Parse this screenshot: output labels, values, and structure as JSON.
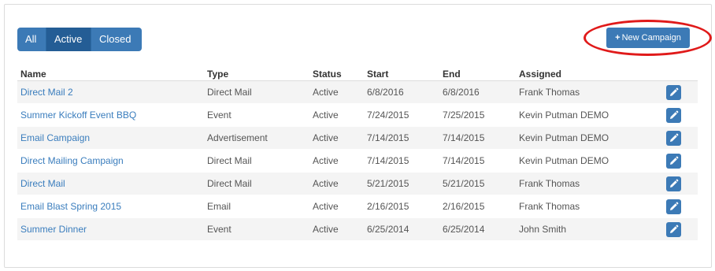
{
  "filters": [
    {
      "label": "All",
      "active": false
    },
    {
      "label": "Active",
      "active": true
    },
    {
      "label": "Closed",
      "active": false
    }
  ],
  "new_campaign_label": "New Campaign",
  "highlight_color": "#e01a1a",
  "accent_color": "#3c7ab6",
  "columns": [
    "Name",
    "Type",
    "Status",
    "Start",
    "End",
    "Assigned"
  ],
  "rows": [
    {
      "name": "Direct Mail 2",
      "type": "Direct Mail",
      "status": "Active",
      "start": "6/8/2016",
      "end": "6/8/2016",
      "assigned": "Frank Thomas"
    },
    {
      "name": "Summer Kickoff Event BBQ",
      "type": "Event",
      "status": "Active",
      "start": "7/24/2015",
      "end": "7/25/2015",
      "assigned": "Kevin Putman DEMO"
    },
    {
      "name": "Email Campaign",
      "type": "Advertisement",
      "status": "Active",
      "start": "7/14/2015",
      "end": "7/14/2015",
      "assigned": "Kevin Putman DEMO"
    },
    {
      "name": "Direct Mailing Campaign",
      "type": "Direct Mail",
      "status": "Active",
      "start": "7/14/2015",
      "end": "7/14/2015",
      "assigned": "Kevin Putman DEMO"
    },
    {
      "name": "Direct Mail",
      "type": "Direct Mail",
      "status": "Active",
      "start": "5/21/2015",
      "end": "5/21/2015",
      "assigned": "Frank Thomas"
    },
    {
      "name": "Email Blast Spring 2015",
      "type": "Email",
      "status": "Active",
      "start": "2/16/2015",
      "end": "2/16/2015",
      "assigned": "Frank Thomas"
    },
    {
      "name": "Summer Dinner",
      "type": "Event",
      "status": "Active",
      "start": "6/25/2014",
      "end": "6/25/2014",
      "assigned": "John Smith"
    }
  ]
}
